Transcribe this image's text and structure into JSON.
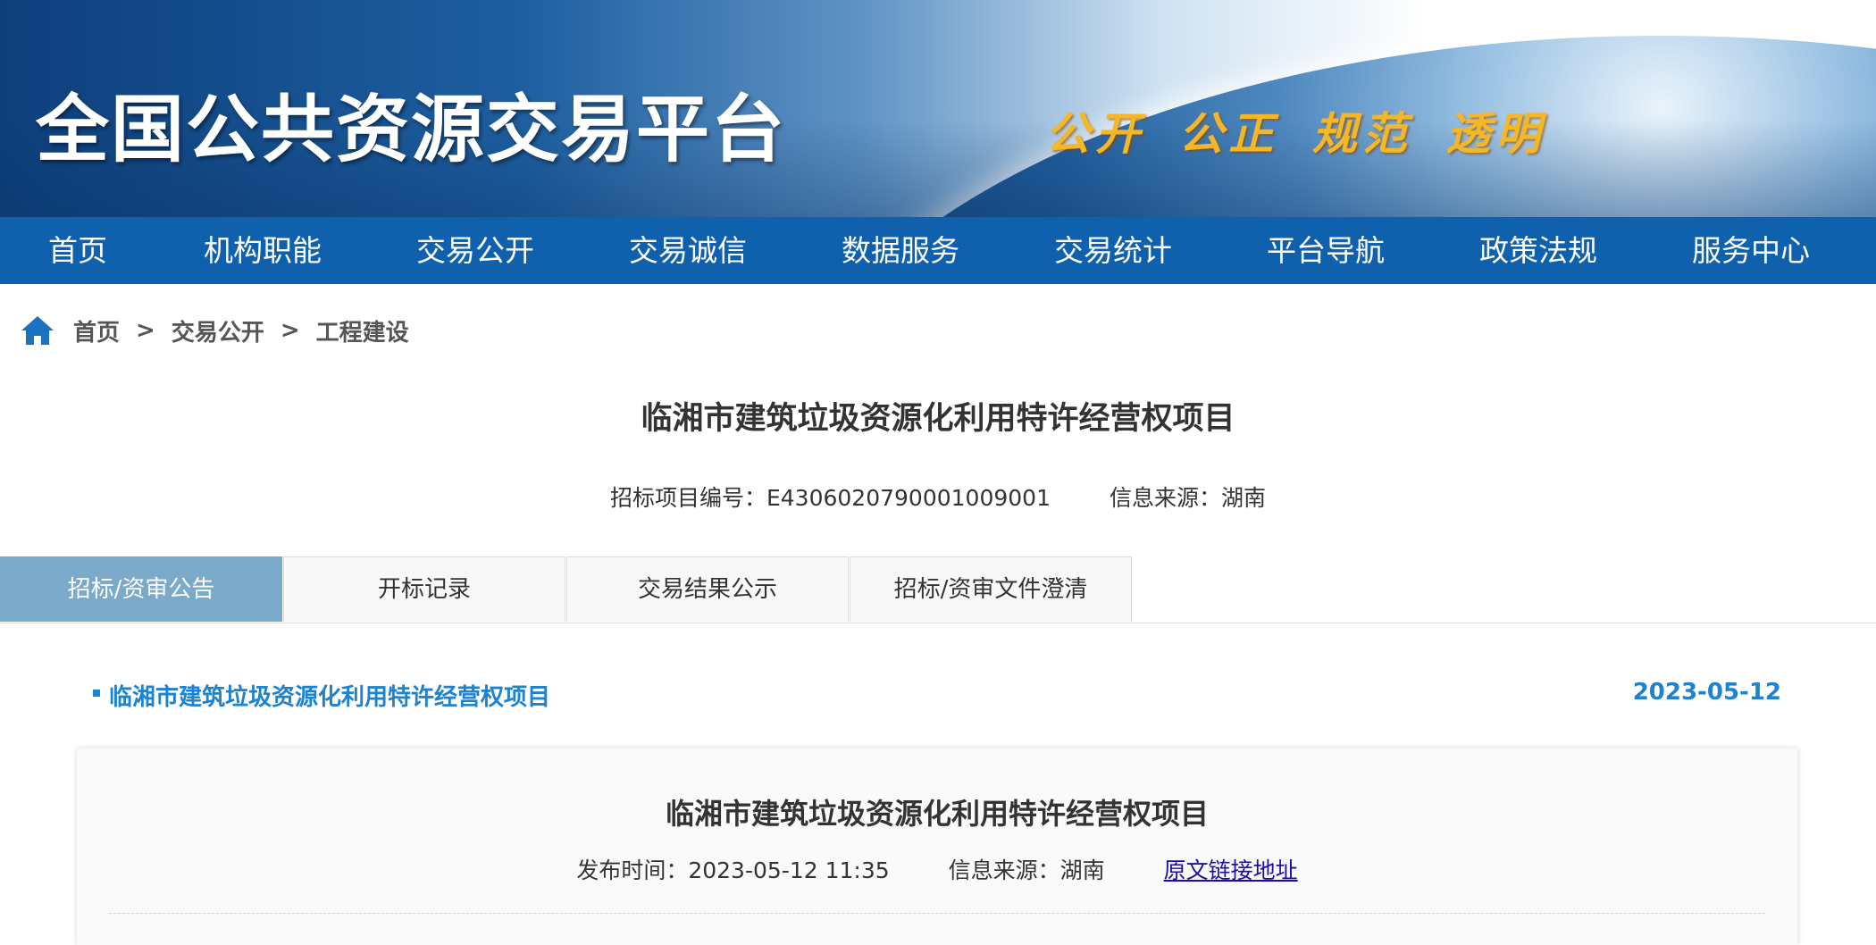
{
  "header": {
    "site_title": "全国公共资源交易平台",
    "slogan": "公开 公正 规范 透明"
  },
  "nav": {
    "items": [
      "首页",
      "机构职能",
      "交易公开",
      "交易诚信",
      "数据服务",
      "交易统计",
      "平台导航",
      "政策法规",
      "服务中心"
    ]
  },
  "breadcrumb": {
    "items": [
      "首页",
      "交易公开",
      "工程建设"
    ],
    "separator": ">"
  },
  "project": {
    "title": "临湘市建筑垃圾资源化利用特许经营权项目",
    "code_label": "招标项目编号：",
    "code_value": "E4306020790001009001",
    "source_label": "信息来源：",
    "source_value": "湖南"
  },
  "tabs": {
    "items": [
      "招标/资审公告",
      "开标记录",
      "交易结果公示",
      "招标/资审文件澄清"
    ],
    "active_index": 0
  },
  "announcement": {
    "title": "临湘市建筑垃圾资源化利用特许经营权项目",
    "date": "2023-05-12"
  },
  "article": {
    "title": "临湘市建筑垃圾资源化利用特许经营权项目",
    "publish_label": "发布时间：",
    "publish_value": "2023-05-12 11:35",
    "source_label": "信息来源：",
    "source_value": "湖南",
    "original_link": "原文链接地址"
  },
  "colors": {
    "nav_bg": "#1061ad",
    "active_tab": "#7aa9c9",
    "link_blue": "#1d82d0",
    "slogan": "#f4b728"
  }
}
